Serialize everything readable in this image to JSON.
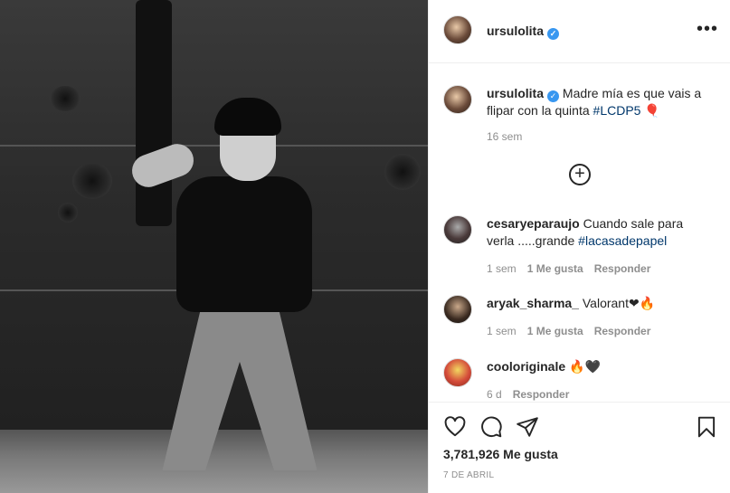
{
  "post": {
    "author": "ursulolita",
    "verified_mark": "✓",
    "more_label": "•••"
  },
  "caption": {
    "username": "ursulolita",
    "text": "Madre mía es que vais a flipar con la quinta",
    "hashtag": "#LCDP5",
    "emoji": "🎈",
    "time": "16 sem"
  },
  "load_more_label": "+",
  "comments": [
    {
      "username": "cesaryeparaujo",
      "text": "Cuando sale para verla .....grande",
      "hashtag": "#lacasadepapel",
      "time": "1 sem",
      "likes": "1 Me gusta",
      "reply": "Responder"
    },
    {
      "username": "aryak_sharma_",
      "text": "Valorant",
      "emoji": "❤🔥",
      "time": "1 sem",
      "likes": "1 Me gusta",
      "reply": "Responder"
    },
    {
      "username": "cooloriginale",
      "emoji": "🔥🖤",
      "time": "6 d",
      "reply": "Responder"
    }
  ],
  "stats": {
    "likes": "3,781,926 Me gusta",
    "date": "7 DE ABRIL"
  },
  "colors": {
    "link": "#00376b",
    "verified": "#3897f0",
    "muted": "#8e8e8e",
    "text": "#262626"
  },
  "icons": [
    "heart-icon",
    "comment-icon",
    "share-icon",
    "bookmark-icon",
    "more-icon",
    "verified-icon",
    "plus-circle-icon"
  ]
}
